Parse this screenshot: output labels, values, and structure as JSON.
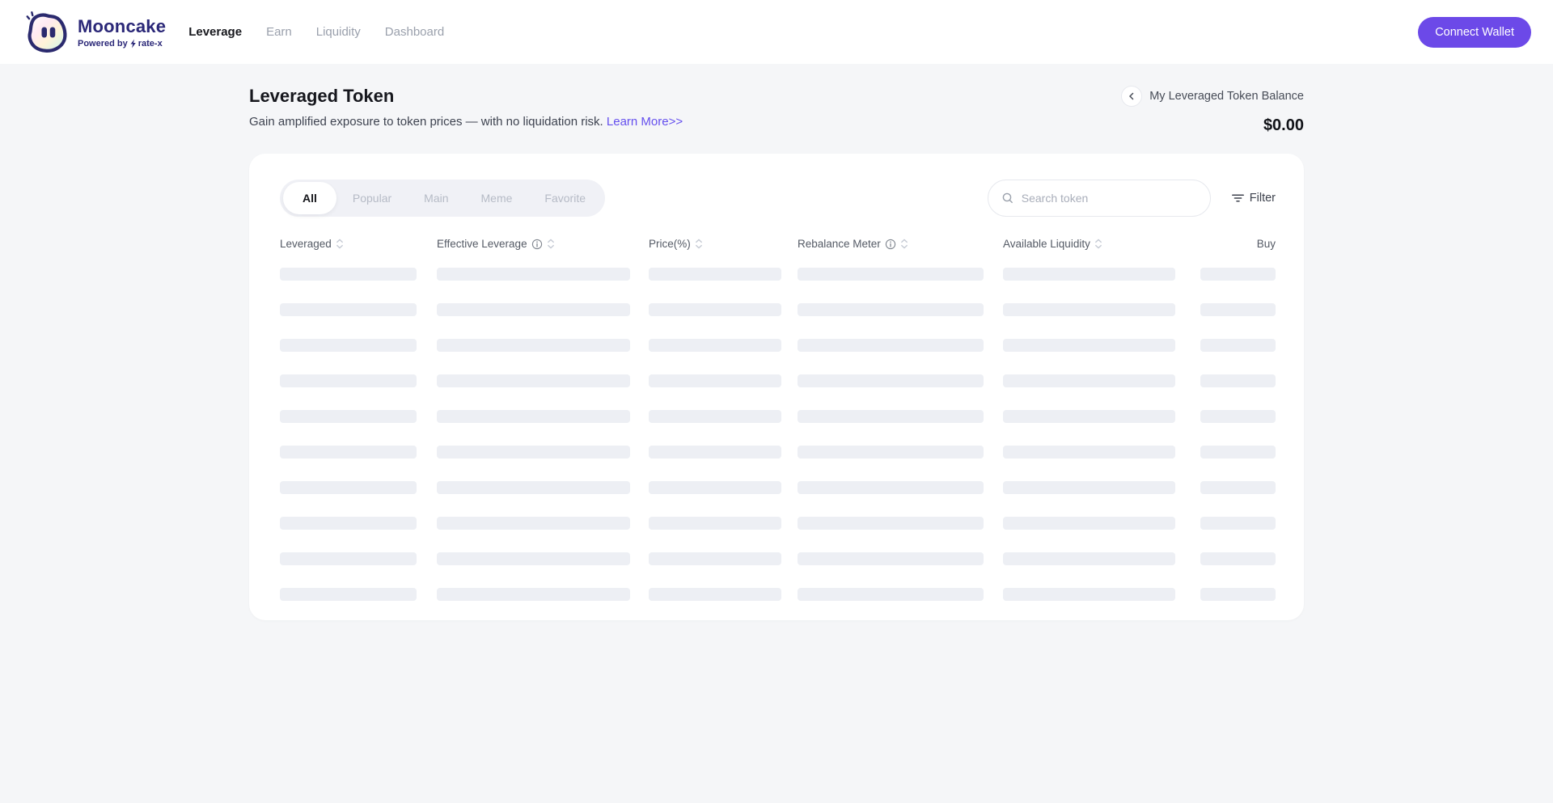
{
  "brand": {
    "name": "Mooncake",
    "tagline_prefix": "Powered by",
    "tagline_suffix": "rate-x"
  },
  "nav": {
    "items": [
      {
        "label": "Leverage",
        "active": true
      },
      {
        "label": "Earn",
        "active": false
      },
      {
        "label": "Liquidity",
        "active": false
      },
      {
        "label": "Dashboard",
        "active": false
      }
    ]
  },
  "wallet": {
    "connect_label": "Connect Wallet"
  },
  "page": {
    "title": "Leveraged Token",
    "subtitle": "Gain amplified exposure to token prices — with no liquidation risk.",
    "learn_more": "Learn More>>"
  },
  "balance": {
    "label": "My Leveraged Token Balance",
    "value": "$0.00"
  },
  "tabs": {
    "items": [
      {
        "label": "All",
        "active": true
      },
      {
        "label": "Popular",
        "active": false
      },
      {
        "label": "Main",
        "active": false
      },
      {
        "label": "Meme",
        "active": false
      },
      {
        "label": "Favorite",
        "active": false
      }
    ]
  },
  "search": {
    "placeholder": "Search token"
  },
  "filter": {
    "label": "Filter"
  },
  "table": {
    "columns": [
      {
        "label": "Leveraged",
        "sortable": true,
        "info": false
      },
      {
        "label": "Effective Leverage",
        "sortable": true,
        "info": true
      },
      {
        "label": "Price(%)",
        "sortable": true,
        "info": false
      },
      {
        "label": "Rebalance Meter",
        "sortable": true,
        "info": true
      },
      {
        "label": "Available Liquidity",
        "sortable": true,
        "info": false
      },
      {
        "label": "Buy",
        "sortable": false,
        "info": false
      }
    ],
    "state": "loading",
    "skeleton_rows": 10
  },
  "colors": {
    "accent_purple": "#6C49E8",
    "link_purple": "#6550EE",
    "brand_navy": "#2B2878",
    "page_background": "#F5F6F8",
    "skeleton_gray": "#EDEFF4"
  }
}
